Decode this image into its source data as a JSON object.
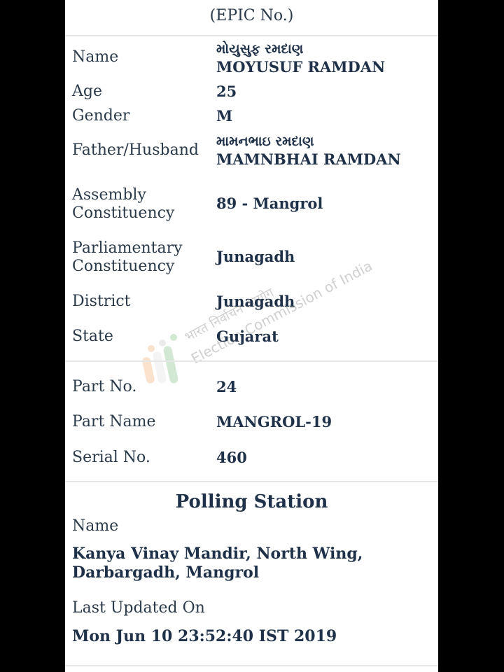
{
  "header": {
    "epic_label": "(EPIC No.)"
  },
  "details": {
    "name_label": "Name",
    "name_gujarati": "મોયુસુફ રમદાણ",
    "name_english": "MOYUSUF RAMDAN",
    "age_label": "Age",
    "age_value": "25",
    "gender_label": "Gender",
    "gender_value": "M",
    "relative_label": "Father/Husband",
    "relative_gujarati": "મામનભાઇ રમદાણ",
    "relative_english": "MAMNBHAI RAMDAN",
    "assembly_label_line1": "Assembly",
    "assembly_label_line2": "Constituency",
    "assembly_value": "89 - Mangrol",
    "parliamentary_label_line1": "Parliamentary",
    "parliamentary_label_line2": "Constituency",
    "parliamentary_value": "Junagadh",
    "district_label": "District",
    "district_value": "Junagadh",
    "state_label": "State",
    "state_value": "Gujarat"
  },
  "part": {
    "part_no_label": "Part No.",
    "part_no_value": "24",
    "part_name_label": "Part Name",
    "part_name_value": "MANGROL-19",
    "serial_label": "Serial No.",
    "serial_value": "460"
  },
  "polling_station": {
    "heading": "Polling Station",
    "name_label": "Name",
    "name_value": "Kanya Vinay Mandir, North Wing,\nDarbargadh, Mangrol",
    "updated_label": "Last Updated On",
    "updated_value": "Mon Jun 10 23:52:40 IST 2019"
  },
  "watermark": {
    "hindi_text": "भारत निर्वाचन आयोग",
    "english_text": "Election Commission of India",
    "icon": "eci-logo-icon"
  },
  "colors": {
    "background": "#000000",
    "card": "#ffffff",
    "label_text": "#2b3a4a",
    "value_text": "#1f3148",
    "divider": "#e6e6e6"
  }
}
